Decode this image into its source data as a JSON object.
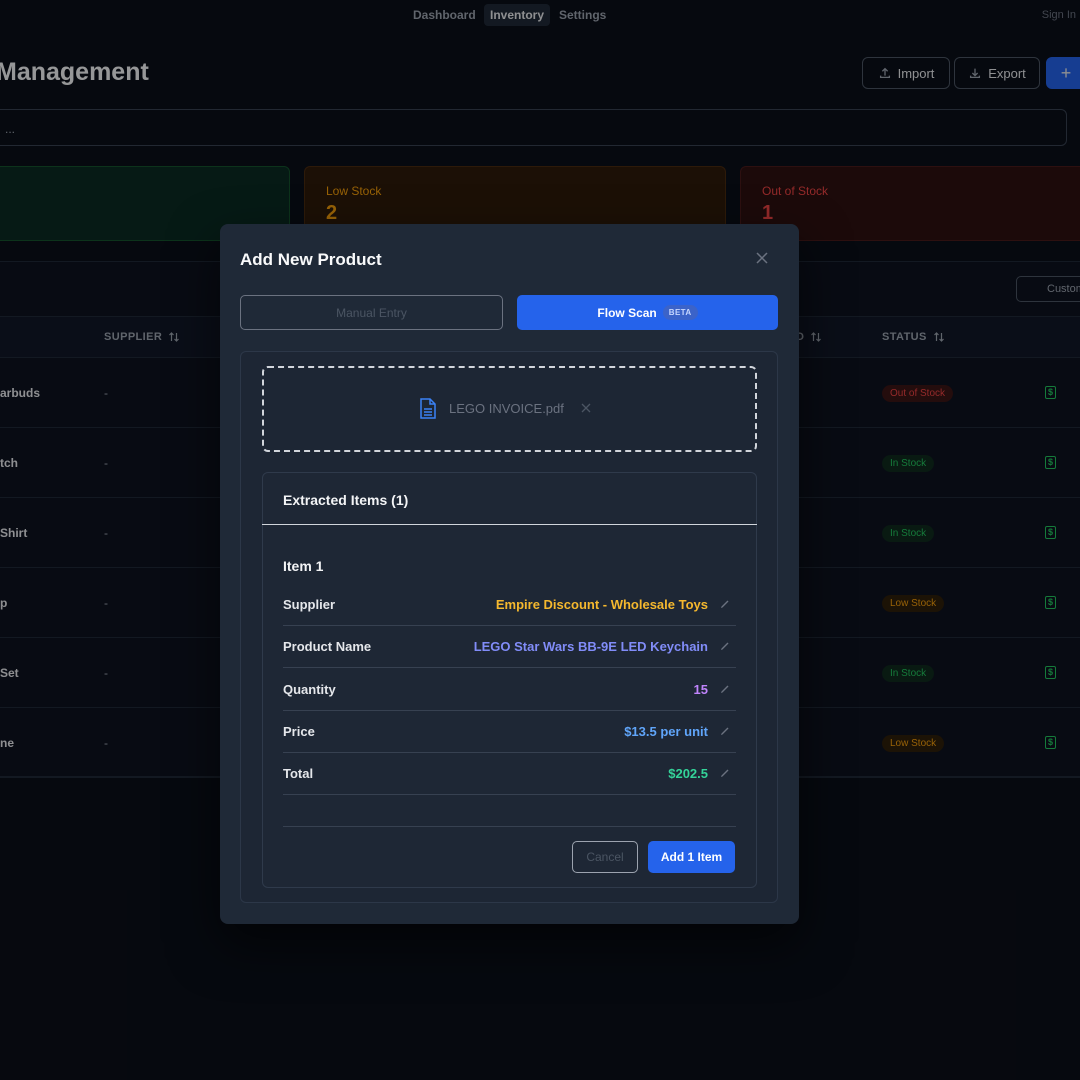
{
  "nav": {
    "links": [
      {
        "label": "Dashboard",
        "active": false
      },
      {
        "label": "Inventory",
        "active": true
      },
      {
        "label": "Settings",
        "active": false
      }
    ],
    "sign_in": "Sign In"
  },
  "page": {
    "title": "Management",
    "import_label": "Import",
    "export_label": "Export",
    "add_label": "+",
    "search_placeholder": "..."
  },
  "cards": {
    "low_stock": {
      "label": "Low Stock",
      "value": "2"
    },
    "out_of_stock": {
      "label": "Out of Stock",
      "value": "1"
    }
  },
  "table": {
    "customize_label": "Custom",
    "headers": {
      "supplier": "SUPPLIER",
      "col_d": "D",
      "status": "STATUS"
    },
    "rows": [
      {
        "name": "arbuds",
        "supplier": "-",
        "status": "Out of Stock",
        "status_type": "out"
      },
      {
        "name": "tch",
        "supplier": "-",
        "status": "In Stock",
        "status_type": "in"
      },
      {
        "name": "Shirt",
        "supplier": "-",
        "status": "In Stock",
        "status_type": "in"
      },
      {
        "name": "p",
        "supplier": "-",
        "status": "Low Stock",
        "status_type": "low"
      },
      {
        "name": "Set",
        "supplier": "-",
        "status": "In Stock",
        "status_type": "in"
      },
      {
        "name": "ne",
        "supplier": "-",
        "status": "Low Stock",
        "status_type": "low"
      }
    ]
  },
  "modal": {
    "title": "Add New Product",
    "tab_manual": "Manual Entry",
    "tab_flow": "Flow Scan",
    "beta": "BETA",
    "file_name": "LEGO INVOICE.pdf",
    "extracted_title": "Extracted Items (1)",
    "item_title": "Item 1",
    "fields": [
      {
        "label": "Supplier",
        "value": "Empire Discount - Wholesale Toys",
        "color": "#f5b82e"
      },
      {
        "label": "Product Name",
        "value": "LEGO Star Wars BB-9E LED Keychain",
        "color": "#818cf8"
      },
      {
        "label": "Quantity",
        "value": "15",
        "color": "#c084fc"
      },
      {
        "label": "Price",
        "value": "$13.5 per unit",
        "color": "#60a5fa"
      },
      {
        "label": "Total",
        "value": "$202.5",
        "color": "#34d399"
      }
    ],
    "cancel_label": "Cancel",
    "add_label": "Add 1 Item"
  },
  "colors": {
    "accent": "#2563eb",
    "background": "#0b0f19",
    "modal_bg": "#1f2937"
  }
}
